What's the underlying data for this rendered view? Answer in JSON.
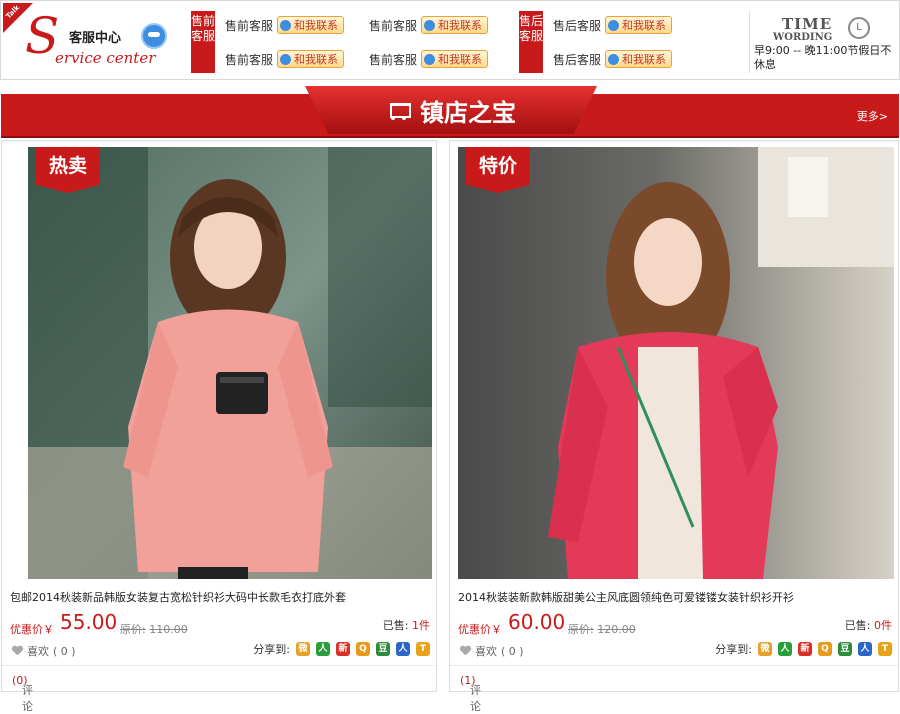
{
  "header": {
    "talk_label": "Talk",
    "logo_letter": "S",
    "service_title": "客服中心",
    "service_subtitle": "ervice center",
    "presale_label": "售前客服",
    "aftersale_label": "售后客服",
    "contact_button": "和我联系",
    "presale_agents": [
      "售前客服",
      "售前客服",
      "售前客服",
      "售前客服"
    ],
    "aftersale_agents": [
      "售后客服",
      "售后客服"
    ],
    "time_title": "TIME",
    "time_subtitle": "WORDING",
    "clock_glyph": "L",
    "hours": "早9:00 -- 晚11:00节假日不休息"
  },
  "banner": {
    "title": "镇店之宝",
    "more": "更多>"
  },
  "products": [
    {
      "tag": "热卖",
      "title": "包邮2014秋装新品韩版女装复古宽松针织衫大码中长款毛衣打底外套",
      "price_label": "优惠价￥",
      "price": "55.00",
      "orig_label": "原价:",
      "orig_price": "110.00",
      "sold_label": "已售:",
      "sold_count": "1件",
      "like_label": "喜欢",
      "like_count": "( 0 )",
      "share_label": "分享到:",
      "comment_label": "评论",
      "comment_count": "(0)"
    },
    {
      "tag": "特价",
      "title": "2014秋装装新款韩版甜美公主风底圆领纯色可爱镂镂女装针织衫开衫",
      "price_label": "优惠价￥",
      "price": "60.00",
      "orig_label": "原价:",
      "orig_price": "120.00",
      "sold_label": "已售:",
      "sold_count": "0件",
      "like_label": "喜欢",
      "like_count": "( 0 )",
      "share_label": "分享到:",
      "comment_label": "评论",
      "comment_count": "(1)"
    }
  ],
  "share_icons": [
    {
      "name": "weibo-icon",
      "glyph": "微",
      "color": "#e6a12a"
    },
    {
      "name": "renren-icon",
      "glyph": "人",
      "color": "#2a9d3c"
    },
    {
      "name": "sina-icon",
      "glyph": "新",
      "color": "#d93025"
    },
    {
      "name": "qzone-icon",
      "glyph": "Q",
      "color": "#e89b1a"
    },
    {
      "name": "douban-icon",
      "glyph": "豆",
      "color": "#2e8b3a"
    },
    {
      "name": "people-icon",
      "glyph": "人",
      "color": "#2a67c9"
    },
    {
      "name": "tianya-icon",
      "glyph": "T",
      "color": "#e8a21a"
    }
  ],
  "colors": {
    "brand_red": "#c81a1a"
  }
}
